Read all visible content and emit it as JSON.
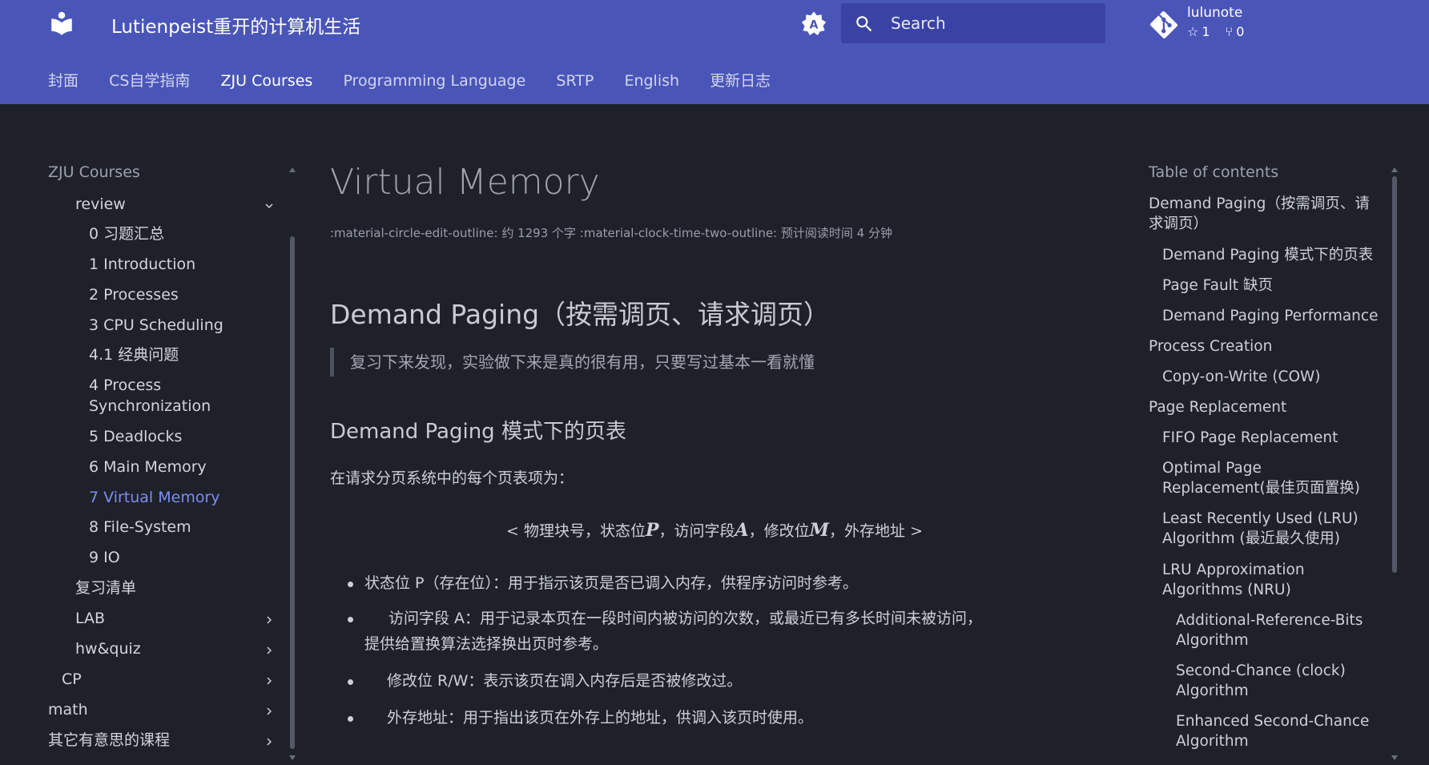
{
  "header": {
    "site_title": "Lutienpeist重开的计算机生活",
    "search_placeholder": "Search",
    "repo": {
      "name": "lulunote",
      "stars": "1",
      "forks": "0"
    }
  },
  "tabs": [
    {
      "label": "封面"
    },
    {
      "label": "CS自学指南"
    },
    {
      "label": "ZJU Courses"
    },
    {
      "label": "Programming Language"
    },
    {
      "label": "SRTP"
    },
    {
      "label": "English"
    },
    {
      "label": "更新日志"
    }
  ],
  "left_nav": {
    "title": "ZJU Courses",
    "review": "review",
    "items": [
      "0 习题汇总",
      "1 Introduction",
      "2 Processes",
      "3 CPU Scheduling",
      "4.1 经典问题",
      "4 Process",
      "Synchronization",
      "5 Deadlocks",
      "6 Main Memory",
      "7 Virtual Memory",
      "8 File-System",
      "9 IO"
    ],
    "review_list": "复习清单",
    "lab": "LAB",
    "hw": "hw&quiz",
    "cp": "CP",
    "math": "math",
    "other": "其它有意思的课程"
  },
  "content": {
    "title": "Virtual Memory",
    "meta": ":material-circle-edit-outline: 约 1293 个字 :material-clock-time-two-outline: 预计阅读时间 4 分钟",
    "h2": "Demand Paging（按需调页、请求调页）",
    "quote": "复习下来发现，实验做下来是真的很有用，只要写过基本一看就懂",
    "h3": "Demand Paging 模式下的页表",
    "para": "在请求分页系统中的每个页表项为：",
    "math": {
      "lt": "<",
      "t1": "物理块号，状态位",
      "v1": "P",
      "t2": "，访问字段",
      "v2": "A",
      "t3": "，修改位",
      "v3": "M",
      "t4": "，外存地址",
      "gt": ">"
    },
    "bullets": [
      "状态位 P（存在位）：用于指示该页是否已调入内存，供程序访问时参考。",
      "访问字段 A：用于记录本页在一段时间内被访问的次数，或最近已有多长时间未被访问，",
      "提供给置换算法选择换出页时参考。",
      "修改位 R/W：表示该页在调入内存后是否被修改过。",
      "外存地址：用于指出该页在外存上的地址，供调入该页时使用。"
    ]
  },
  "toc": {
    "title": "Table of contents",
    "items": [
      "Demand Paging（按需调页、请",
      "求调页）",
      "Demand Paging 模式下的页表",
      "Page Fault 缺页",
      "Demand Paging Performance",
      "Process Creation",
      "Copy-on-Write (COW)",
      "Page Replacement",
      "FIFO Page Replacement",
      "Optimal Page",
      "Replacement(最佳页面置换)",
      "Least Recently Used (LRU)",
      "Algorithm (最近最久使用)",
      "LRU Approximation",
      "Algorithms (NRU)",
      "Additional-Reference-Bits",
      "Algorithm",
      "Second-Chance (clock)",
      "Algorithm",
      "Enhanced Second-Chance",
      "Algorithm"
    ]
  },
  "colors": {
    "header": "#4a55b8",
    "background": "#1e2129",
    "active_link": "#7c8df0"
  }
}
